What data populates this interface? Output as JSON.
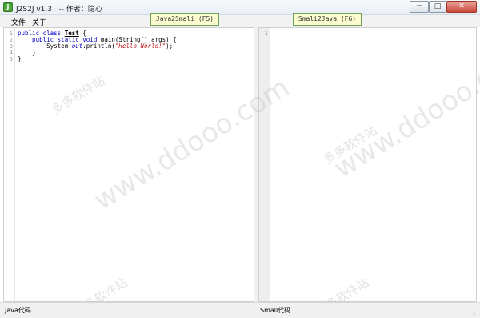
{
  "window": {
    "title": "J2S2J v1.3   -- 作者：隐心",
    "icon": "app-icon",
    "controls": {
      "minimize": "─",
      "maximize": "□",
      "close": "✕"
    }
  },
  "menu": {
    "file": "文件",
    "about": "关于"
  },
  "actions": {
    "java_to_smali": "Java2Smali (F5)",
    "smali_to_java": "Smali2Java (F6)"
  },
  "left_editor": {
    "line_numbers": [
      "1",
      "2",
      "3",
      "4",
      "5"
    ],
    "lines": [
      {
        "parts": [
          {
            "t": "public class ",
            "c": "kw"
          },
          {
            "t": "Test",
            "c": "cls"
          },
          {
            "t": " {",
            "c": ""
          }
        ]
      },
      {
        "parts": [
          {
            "t": "    public static void ",
            "c": "kw"
          },
          {
            "t": "main(String[] args) {",
            "c": ""
          }
        ]
      },
      {
        "parts": [
          {
            "t": "        System.",
            "c": ""
          },
          {
            "t": "out",
            "c": "fld"
          },
          {
            "t": ".println(",
            "c": ""
          },
          {
            "t": "\"Hello World!\"",
            "c": "str"
          },
          {
            "t": ");",
            "c": ""
          }
        ]
      },
      {
        "parts": [
          {
            "t": "    }",
            "c": ""
          }
        ]
      },
      {
        "parts": [
          {
            "t": "}",
            "c": ""
          }
        ]
      }
    ]
  },
  "right_editor": {
    "line_numbers": [
      "1"
    ]
  },
  "status": {
    "left": "Java代码",
    "right": "Small代码"
  },
  "watermark": {
    "url": "www.ddooo.com",
    "cn": "多多软件站"
  }
}
